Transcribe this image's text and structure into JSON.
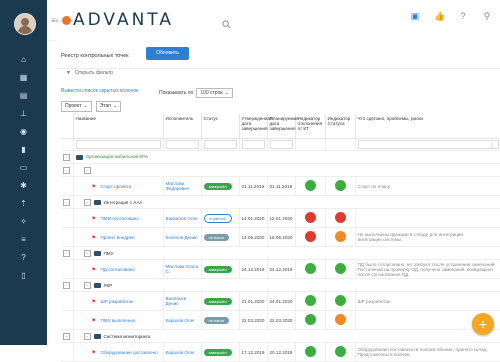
{
  "app": {
    "brand": "ADVANTA"
  },
  "sidebar": {
    "icons": [
      "home-icon",
      "dashboard-icon",
      "folder-icon",
      "hierarchy-icon",
      "globe-icon",
      "chart-icon",
      "document-icon",
      "settings-icon",
      "upload-icon",
      "users-icon",
      "list-icon",
      "help-icon",
      "phone-icon"
    ]
  },
  "topbar": {
    "icons": [
      "bell-icon",
      "like-icon",
      "help-icon",
      "user-icon"
    ]
  },
  "page": {
    "title": "Реестр контрольных точек",
    "refresh_label": "Обновить",
    "filter_label": "Открыть фильтр",
    "hidden_cols_label": "Вывести список скрытых колонок",
    "show_by_label": "Показывать по",
    "show_by_value": "100 строк",
    "project_select": "Проект",
    "stage_select": "Этап"
  },
  "columns": [
    "Название",
    "Исполнитель",
    "Статус",
    "Утвержденная дата завершения",
    "Планируемая дата завершения",
    "Индикатор отклонения от КТ",
    "Индикатор Статуса",
    "Что сделано, проблемы, риски"
  ],
  "rows": [
    {
      "kind": "group",
      "level": 0,
      "label": "Организация мобильной КРА"
    },
    {
      "kind": "group",
      "level": 1,
      "label": ""
    },
    {
      "kind": "task",
      "name": "Старт проекта",
      "assignee": "Маслова Федорович",
      "status": "завершён",
      "status_type": "done",
      "approved": "01.11.2019",
      "planned": "01.11.2019",
      "ind1": "green",
      "ind2": "green",
      "notes": "Старт по плану"
    },
    {
      "kind": "group",
      "level": 1,
      "label": "Интеграция с ААА"
    },
    {
      "kind": "task",
      "name": "ПМИ согласовано",
      "assignee": "Бахвалов Олег",
      "status": "в работе",
      "status_type": "work",
      "approved": "14.01.2020",
      "planned": "12.01.2020",
      "ind1": "red",
      "ind2": "red",
      "notes": ""
    },
    {
      "kind": "task",
      "name": "Проект внедрен",
      "assignee": "Колесов Денис",
      "status": "не начат",
      "status_type": "gray",
      "approved": "14.05.2020",
      "planned": "18.05.2020",
      "ind1": "red",
      "ind2": "orange",
      "notes": "Не выполнены функции в стенде для интеграции",
      "notes2": "интеграции системы"
    },
    {
      "kind": "group",
      "level": 1,
      "label": "ПМУ"
    },
    {
      "kind": "task",
      "name": "ПД согласовано",
      "assignee": "Маслова Ольга С.",
      "status": "завершён",
      "status_type": "done",
      "approved": "24.12.2019",
      "planned": "24.12.2019",
      "ind1": "green",
      "ind2": "green",
      "notes": "ПД было согласовано, но требуют после устранения замечаний. Постоянная на проверку ОД, получено замечаний, возвращено после согласования ПД."
    },
    {
      "kind": "group",
      "level": 1,
      "label": "ЛКР"
    },
    {
      "kind": "task",
      "name": "ШР разработан",
      "assignee": "Васильев Денис",
      "status": "завершён",
      "status_type": "done",
      "approved": "21.01.2020",
      "planned": "24.01.2020",
      "ind1": "green",
      "ind2": "green",
      "notes": "ШР разработан"
    },
    {
      "kind": "task",
      "name": "ПМУ выполнено",
      "assignee": "Карасев Олег",
      "status": "не начат",
      "status_type": "gray",
      "approved": "22.03.2020",
      "planned": "22.03.2020",
      "ind1": "green",
      "ind2": "orange",
      "notes": ""
    },
    {
      "kind": "group",
      "level": 1,
      "label": "Система мониторинга"
    },
    {
      "kind": "task",
      "name": "Оборудование доставлено",
      "assignee": "Карасев Олег",
      "status": "завершён",
      "status_type": "done",
      "approved": "17.12.2019",
      "planned": "20.12.2019",
      "ind1": "green",
      "ind2": "green",
      "notes": "Оборудование поставлено в полном объеме, принято склад. Представлены в полном"
    }
  ]
}
